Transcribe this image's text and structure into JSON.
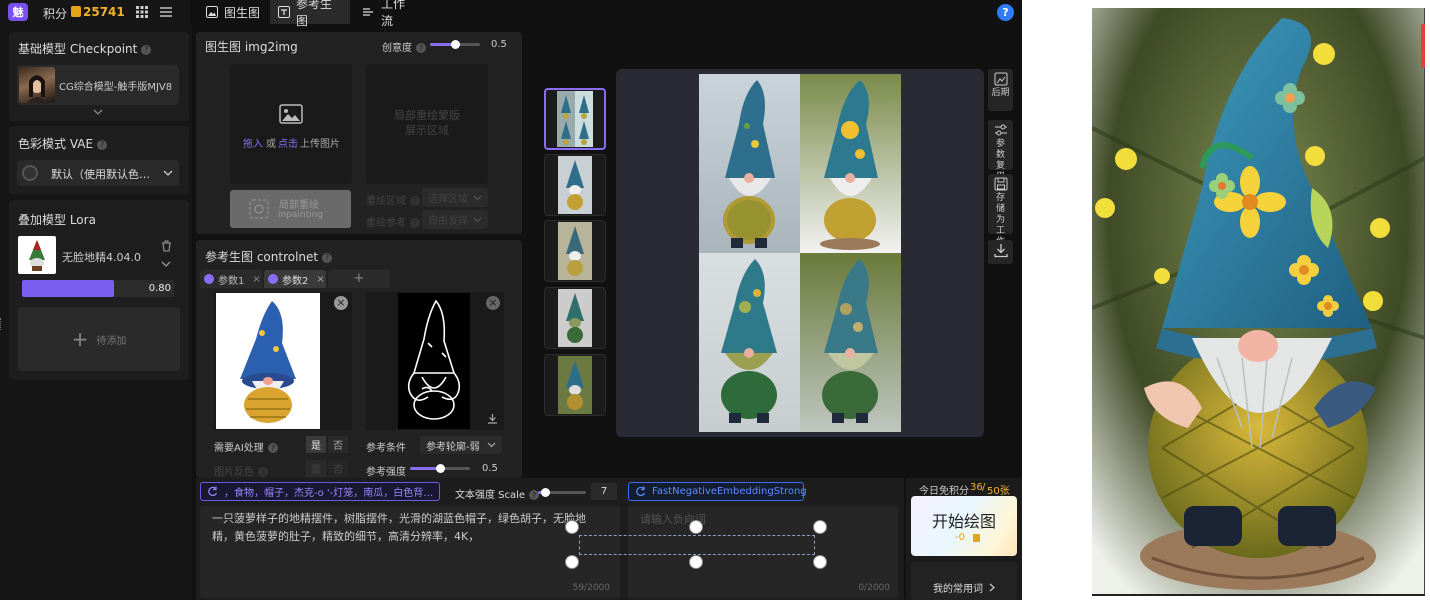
{
  "topbar": {
    "logo_text": "魅",
    "points_label": "积分",
    "points_value": "25741",
    "help": "?"
  },
  "tabs": [
    {
      "label": "图生图"
    },
    {
      "label": "参考生图"
    },
    {
      "label": "工作流"
    }
  ],
  "left": {
    "checkpoint": {
      "title": "基础模型 Checkpoint",
      "model_name": "CG综合模型-触手版MJV8"
    },
    "vae": {
      "title": "色彩模式 VAE",
      "value": "默认（使用默认色…"
    },
    "lora": {
      "title": "叠加模型 Lora",
      "item_name": "无脸地精4.04.0",
      "weight": "0.80",
      "weight_fraction": 0.8,
      "add_label": "待添加"
    }
  },
  "img2img": {
    "title": "图生图 img2img",
    "creativity_label": "创意度",
    "creativity_value": "0.5",
    "creativity_fraction": 0.5,
    "upload_drag": "拖入",
    "upload_or": "或",
    "upload_click": "点击",
    "upload_text": "上传图片",
    "mask_area": "局部重绘蒙版\n展示区域",
    "inpaint_label": "局部重绘",
    "inpaint_sub": "inpainting",
    "redraw_area_label": "重绘区域",
    "redraw_area_value": "选择区域",
    "redraw_ref_label": "重绘参考",
    "redraw_ref_value": "自由发挥"
  },
  "controlnet": {
    "title": "参考生图 controlnet",
    "tab1": "参数1",
    "tab2": "参数2",
    "add": "+",
    "ai_process_label": "需要AI处理",
    "yes": "是",
    "no": "否",
    "image_color_label": "图片反色",
    "ref_condition_label": "参考条件",
    "ref_condition_value": "参考轮廓-弱",
    "ref_strength_label": "参考强度",
    "ref_strength_value": "0.5",
    "ref_strength_fraction": 0.5
  },
  "prompt": {
    "tags": "，食物，帽子，杰克-o '-灯笼，南瓜，白色背…",
    "text_strength_label": "文本强度 Scale",
    "text_strength_value": "7",
    "text_strength_fraction": 0.15,
    "text": "一只菠萝样子的地精摆件，树脂摆件，光滑的湖蓝色帽子，绿色胡子，无脸地精，黄色菠萝的肚子，精致的细节，高清分辨率，4K，",
    "count": "59/2000",
    "neg_tag": "FastNegativeEmbeddingStrong",
    "neg_placeholder": "请输入负向词",
    "neg_count": "0/2000"
  },
  "generate": {
    "free_label": "今日免积分",
    "free_used": "36",
    "free_total": "50张",
    "button_label": "开始绘图",
    "cost": "-0",
    "common_words": "我的常用词",
    "colors": {
      "accent": "#8b6cf6",
      "gold": "#f0b429"
    }
  },
  "side_actions": [
    {
      "label": "后期"
    },
    {
      "label": "参数复用"
    },
    {
      "label": "存储为工作流"
    },
    {
      "label": ""
    }
  ]
}
